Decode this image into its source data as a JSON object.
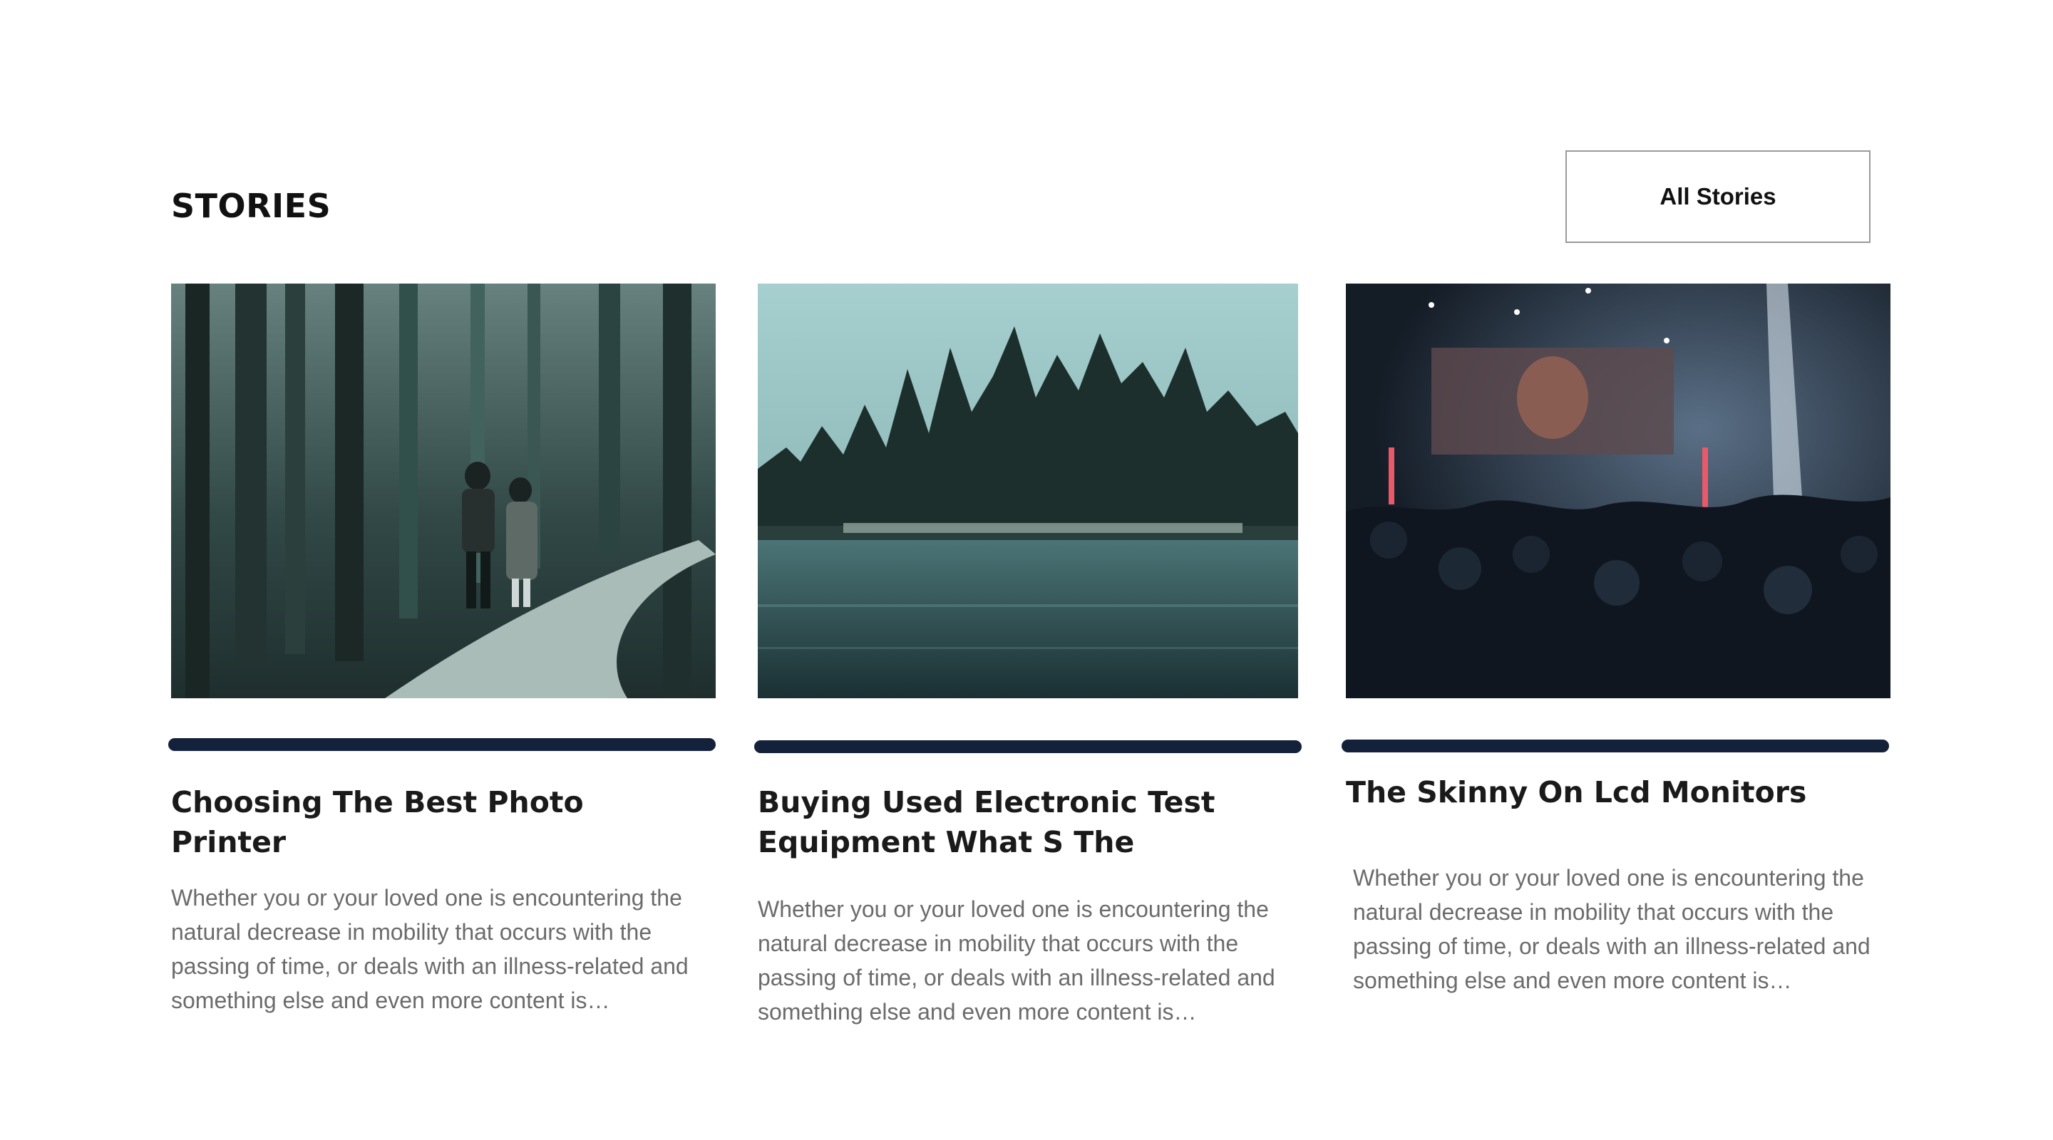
{
  "section": {
    "title": "STORIES",
    "all_button_label": "All Stories"
  },
  "stories": [
    {
      "image": "forest-path-couple-photo",
      "title_line1": "Choosing The Best Photo",
      "title_line2": "Printer",
      "excerpt": "Whether you or your loved one is encountering the natural decrease in mobility that occurs with the passing of time, or deals with an illness-related and something else and even more content is…"
    },
    {
      "image": "lake-forest-island-photo",
      "title_line1": "Buying Used Electronic Test",
      "title_line2": "Equipment What S The",
      "excerpt": "Whether you or your loved one is encountering the natural decrease in mobility that occurs with the passing of time, or deals with an illness-related and something else and even more content is…"
    },
    {
      "image": "concert-crowd-photo",
      "title_line1": "The Skinny On Lcd Monitors",
      "title_line2": "",
      "excerpt": "Whether you or your loved one is encountering the natural decrease in mobility that occurs with the passing of time, or deals with an illness-related and something else and even more content is…"
    }
  ],
  "colors": {
    "bar": "#14213a",
    "title_text": "#1a1a1a",
    "excerpt_text": "#6b6b6b",
    "button_border": "#9a9a9a"
  }
}
